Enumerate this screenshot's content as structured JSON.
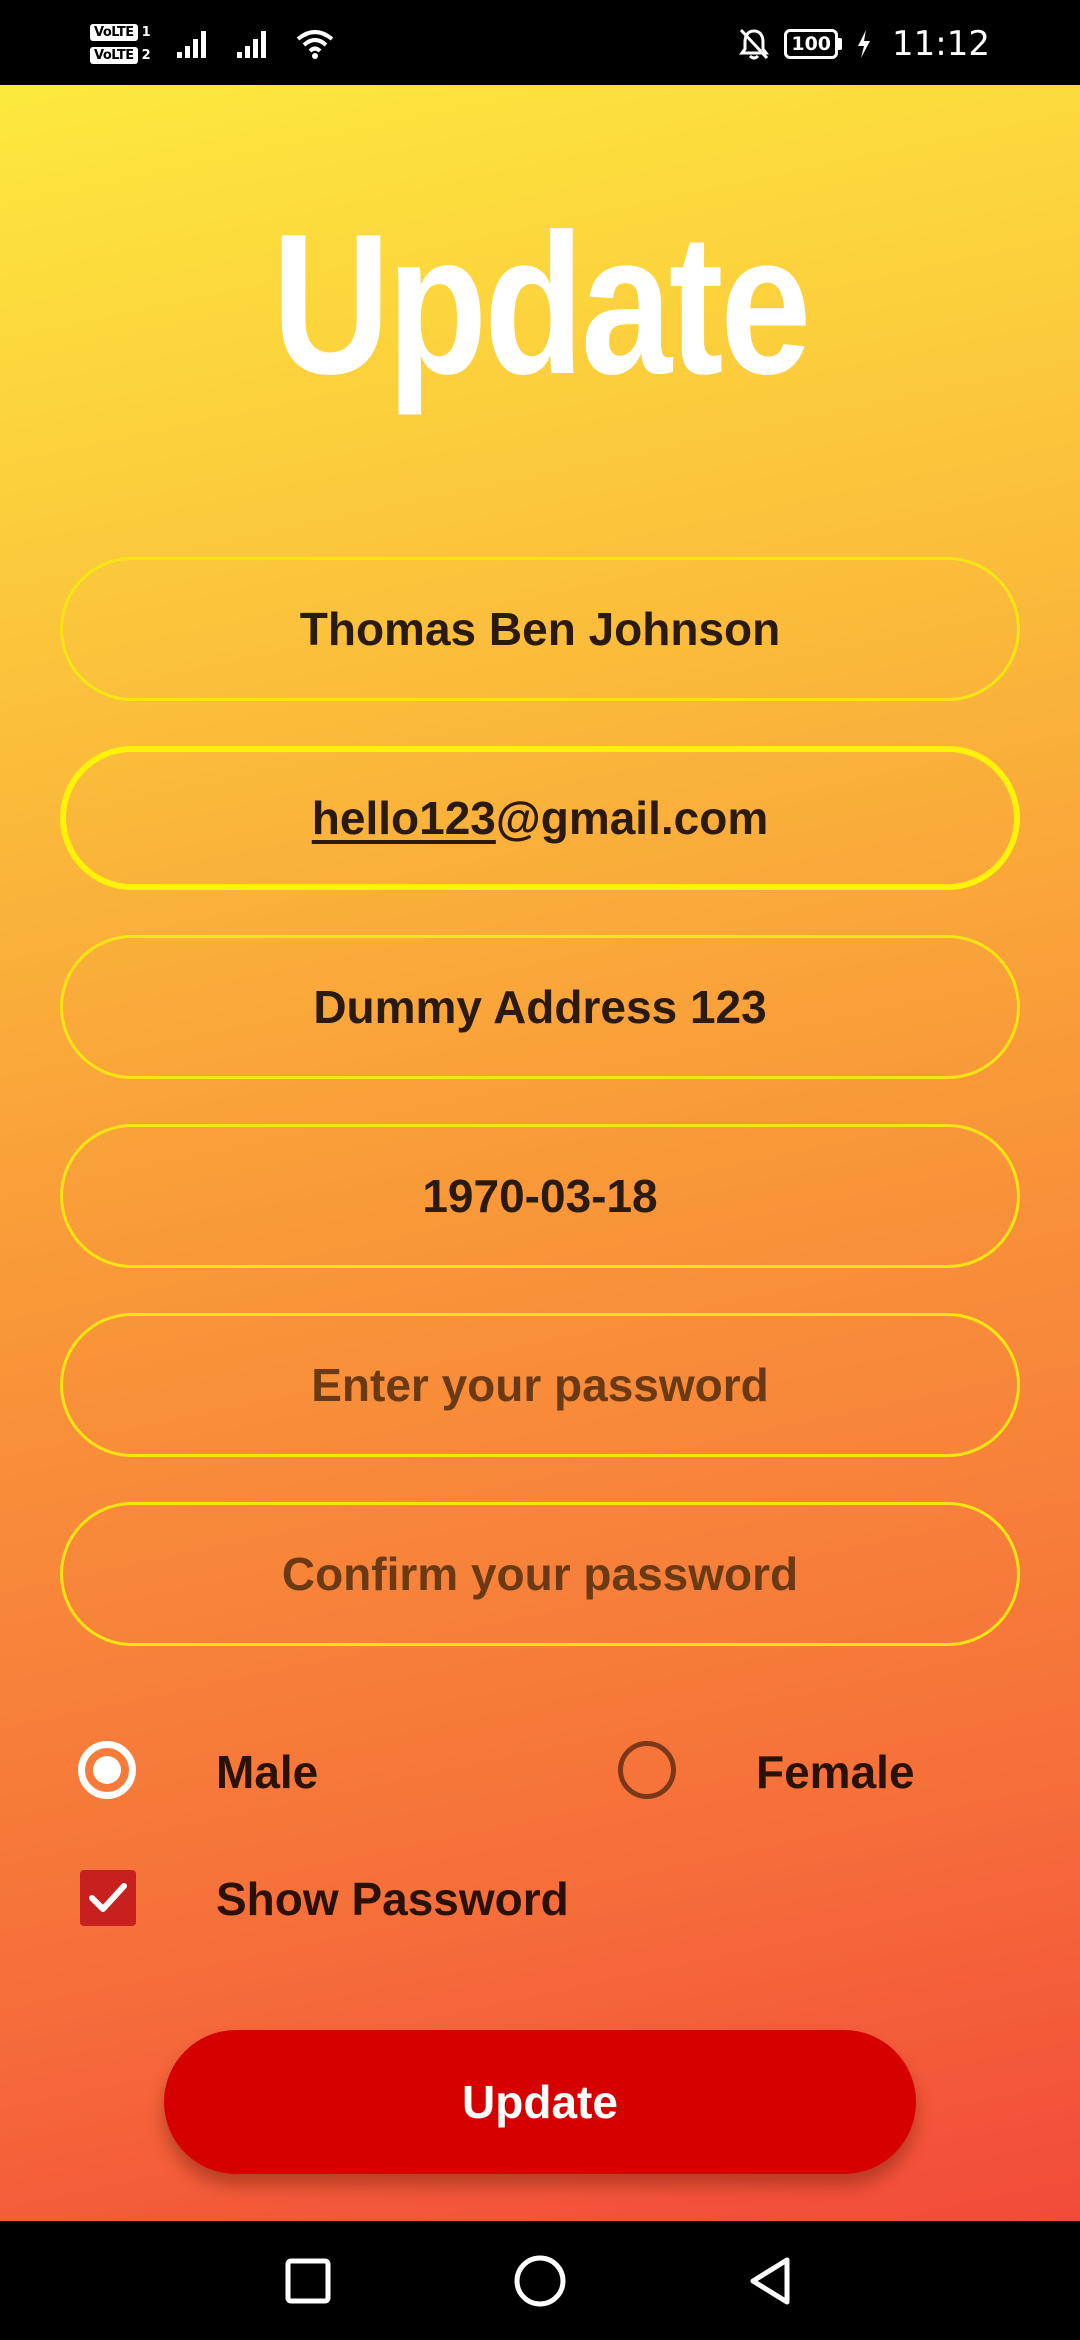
{
  "status_bar": {
    "sim1": "VoLTE",
    "sim1_num": "1",
    "sim2": "VoLTE",
    "sim2_num": "2",
    "battery": "100",
    "time": "11:12",
    "icons": [
      "signal-icon",
      "signal-icon",
      "wifi-icon",
      "mute-notification-icon",
      "battery-icon",
      "charging-icon"
    ]
  },
  "page": {
    "title": "Update"
  },
  "form": {
    "name_value": "Thomas Ben Johnson",
    "email_user": "hello123",
    "email_domain": "@gmail.com",
    "address_value": "Dummy Address 123",
    "dob_value": "1970-03-18",
    "password_placeholder": "Enter your password",
    "confirm_placeholder": "Confirm your password",
    "gender_male": "Male",
    "gender_female": "Female",
    "gender_selected": "Male",
    "show_password_label": "Show Password",
    "show_password_checked": true,
    "submit_label": "Update"
  },
  "colors": {
    "gradient_top": "#fde93e",
    "gradient_bottom": "#f24a3a",
    "field_border": "#f6e413",
    "button": "#d60000",
    "checkbox": "#c8201f"
  },
  "nav_bar": {
    "icons": [
      "recents-square-icon",
      "home-circle-icon",
      "back-triangle-icon"
    ]
  }
}
